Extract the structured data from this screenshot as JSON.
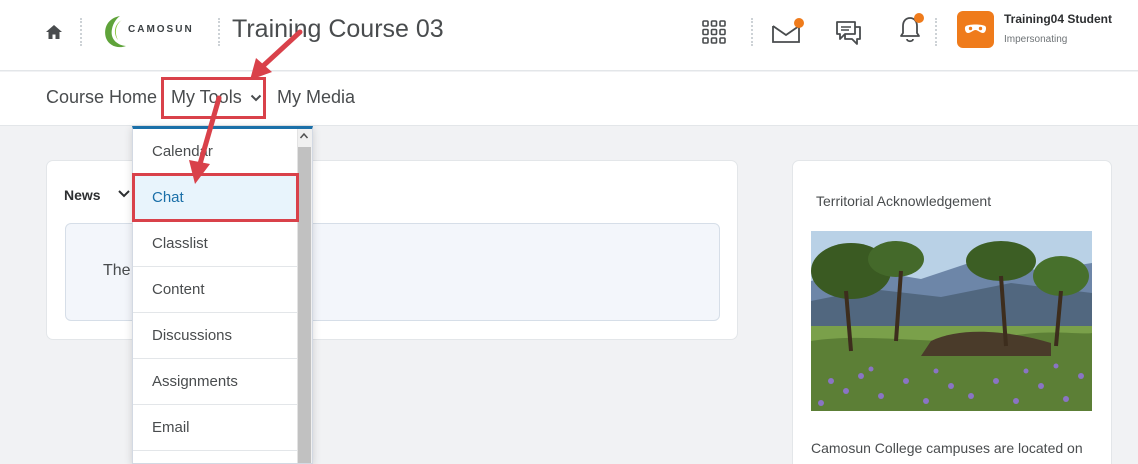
{
  "header": {
    "brand_label": "CAMOSUN",
    "course_title": "Training Course 03",
    "user_name": "Training04 Student",
    "user_status": "Impersonating",
    "accent_color": "#ef7b1b",
    "icons": [
      "home-icon",
      "waffle-icon",
      "mail-icon",
      "chat-bubble-icon",
      "bell-icon"
    ]
  },
  "nav": {
    "items": [
      {
        "label": "Course Home"
      },
      {
        "label": "My Tools"
      },
      {
        "label": "My Media"
      }
    ]
  },
  "dropdown": {
    "items": [
      {
        "label": "Calendar"
      },
      {
        "label": "Chat"
      },
      {
        "label": "Classlist"
      },
      {
        "label": "Content"
      },
      {
        "label": "Discussions"
      },
      {
        "label": "Assignments"
      },
      {
        "label": "Email"
      }
    ],
    "selected": "Chat"
  },
  "news": {
    "title": "News",
    "partial_text": "The"
  },
  "acknowledgement": {
    "title": "Territorial Acknowledgement",
    "text": "Camosun College campuses are located on"
  },
  "annotation_color": "#d9414a"
}
